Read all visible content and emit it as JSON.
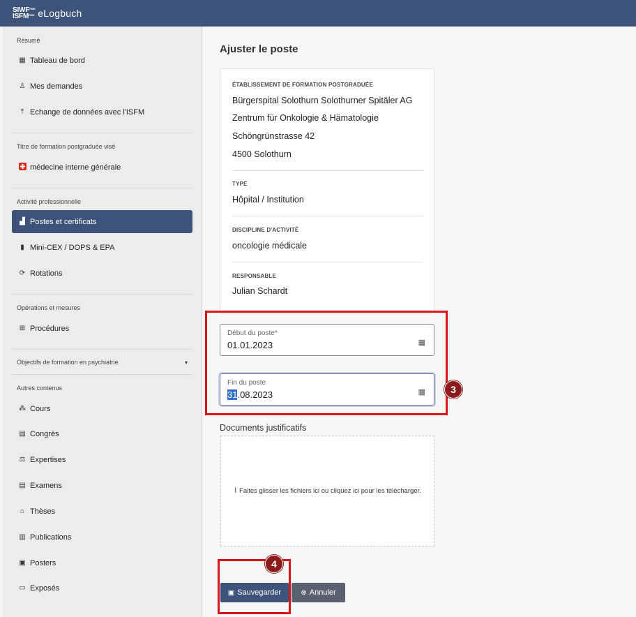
{
  "app": {
    "logo_line1": "SIWF",
    "logo_line2": "ISFM",
    "logo_sub1": "FMH",
    "logo_sub2": "FMH",
    "title": "eLogbuch"
  },
  "sidebar": {
    "sections": {
      "resume": "Résumé",
      "titre": "Titre de formation postgraduée visé",
      "activite": "Activité professionnelle",
      "operations": "Opérations et mesures",
      "objectifs": "Objectifs de formation en psychiatrie",
      "autres": "Autres contenus"
    },
    "items": {
      "tableau": "Tableau de bord",
      "demandes": "Mes demandes",
      "echange": "Echange de données avec l'ISFM",
      "medecine": "médecine interne générale",
      "postes": "Postes et certificats",
      "minicex": "Mini-CEX / DOPS & EPA",
      "rotations": "Rotations",
      "procedures": "Procédures",
      "cours": "Cours",
      "congres": "Congrès",
      "expertises": "Expertises",
      "examens": "Examens",
      "theses": "Thèses",
      "publications": "Publications",
      "posters": "Posters",
      "exposes": "Exposés"
    }
  },
  "main": {
    "title": "Ajuster le poste",
    "etablissement_label": "ÉTABLISSEMENT DE FORMATION POSTGRADUÉE",
    "etablissement_lines": [
      "Bürgerspital Solothurn Solothurner Spitäler AG",
      "Zentrum für Onkologie & Hämatologie",
      "Schöngrünstrasse 42",
      "4500 Solothurn"
    ],
    "type_label": "TYPE",
    "type_value": "Hôpital / Institution",
    "discipline_label": "DISCIPLINE D'ACTIVITÉ",
    "discipline_value": "oncologie médicale",
    "responsable_label": "RESPONSABLE",
    "responsable_value": "Julian Schardt",
    "debut_label": "Début du poste*",
    "debut_value": "01.01.2023",
    "fin_label": "Fin du poste",
    "fin_value_selected": "31",
    "fin_value_rest": ".08.2023",
    "docs_label": "Documents justificatifs",
    "dropzone_text": "Faites glisser les fichiers ici ou cliquez ici pour les télécharger.",
    "save_label": "Sauvegarder",
    "cancel_label": "Annuler"
  },
  "annotations": {
    "badge_3": "3",
    "badge_4": "4"
  },
  "colors": {
    "brand": "#3d5379",
    "highlight": "#d8141b",
    "badge": "#8c1b1b"
  }
}
